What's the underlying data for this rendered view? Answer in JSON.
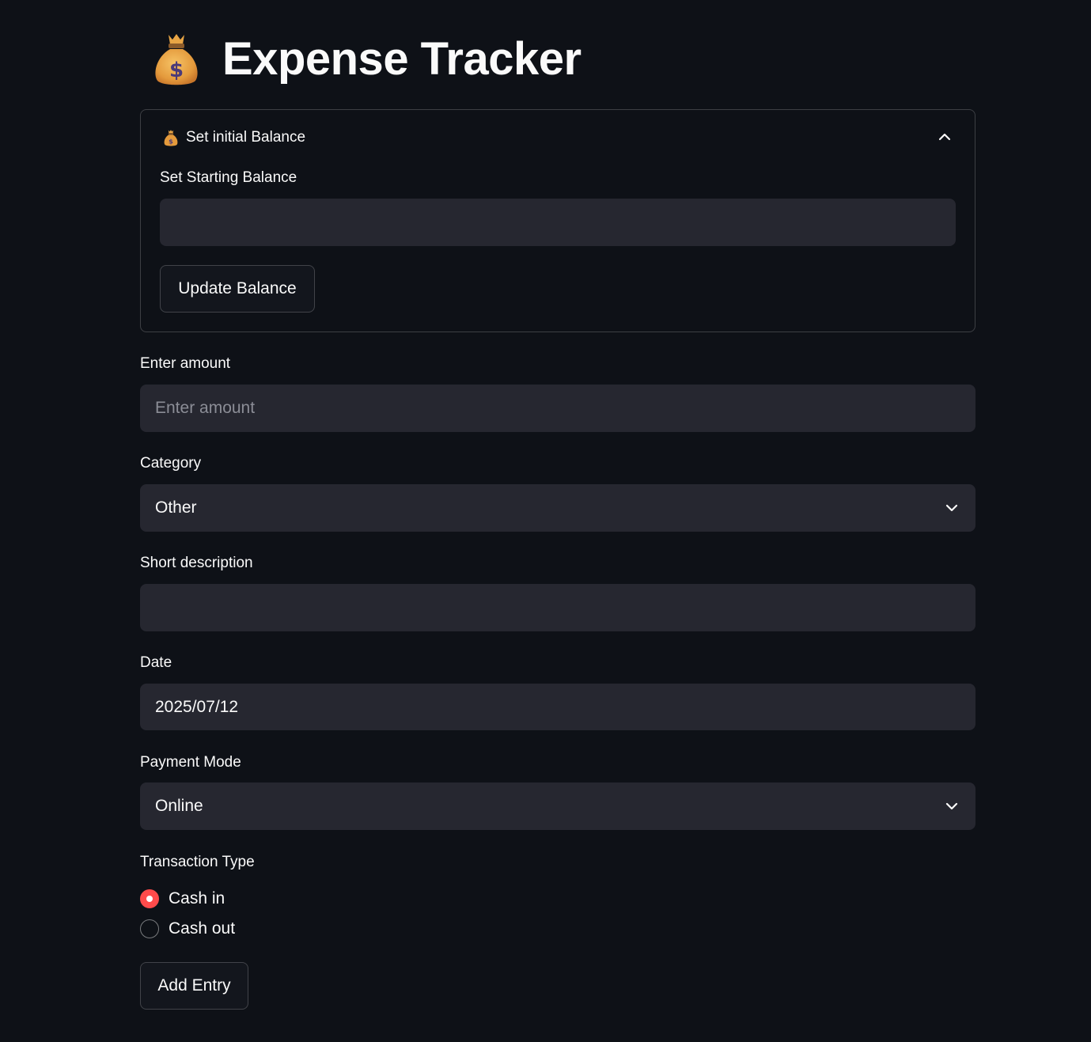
{
  "app": {
    "title": "Expense Tracker",
    "title_icon": "money-bag-icon",
    "accent_color": "#ff4b4b",
    "background_color": "#0e1117",
    "field_color": "#262730"
  },
  "balance_expander": {
    "title": "Set initial Balance",
    "icon": "money-bag-icon",
    "expanded": true,
    "starting_balance_label": "Set Starting Balance",
    "starting_balance_value": "",
    "update_button_label": "Update Balance"
  },
  "form": {
    "amount": {
      "label": "Enter amount",
      "value": "",
      "placeholder": "Enter amount"
    },
    "category": {
      "label": "Category",
      "selected": "Other"
    },
    "description": {
      "label": "Short description",
      "value": ""
    },
    "date": {
      "label": "Date",
      "value": "2025/07/12"
    },
    "payment_mode": {
      "label": "Payment Mode",
      "selected": "Online"
    },
    "transaction_type": {
      "label": "Transaction Type",
      "options": [
        {
          "label": "Cash in",
          "checked": true
        },
        {
          "label": "Cash out",
          "checked": false
        }
      ]
    },
    "submit_label": "Add Entry"
  }
}
